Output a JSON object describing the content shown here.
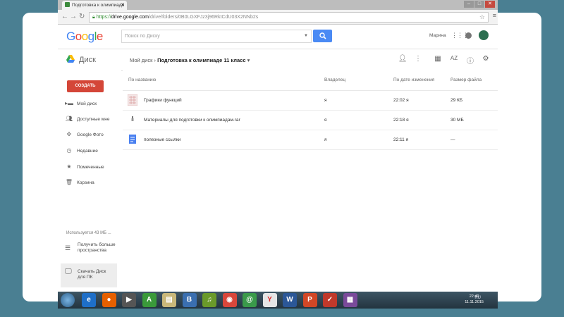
{
  "browser": {
    "tab_title": "Подготовка к олимпиаде",
    "tab_close": "✕",
    "url_scheme": "https://",
    "url_host": "drive.google.com",
    "url_path": "/drive/folders/0B0LGXFJz3j96RktCdU03X2NNb2s"
  },
  "header": {
    "logo_letters": [
      "G",
      "o",
      "o",
      "g",
      "l",
      "e"
    ],
    "logo_colors": [
      "#4285f4",
      "#ea4335",
      "#fbbc05",
      "#4285f4",
      "#34a853",
      "#ea4335"
    ],
    "search_placeholder": "Поиск по Диску",
    "user_name": "Марина"
  },
  "drivebar": {
    "app_name": "Диск",
    "crumb_root": "Мой диск",
    "crumb_sep": "›",
    "crumb_current": "Подготовка к олимпиаде 11 класс"
  },
  "sidebar": {
    "create_label": "СОЗДАТЬ",
    "items": [
      {
        "label": "Мой диск",
        "icon": "folder-icon"
      },
      {
        "label": "Доступные мне",
        "icon": "people-icon"
      },
      {
        "label": "Google Фото",
        "icon": "photos-icon"
      },
      {
        "label": "Недавние",
        "icon": "clock-icon"
      },
      {
        "label": "Помеченные",
        "icon": "star-icon"
      },
      {
        "label": "Корзина",
        "icon": "trash-icon"
      }
    ],
    "storage_text": "Используется 43 МБ ...",
    "get_more_label": "Получить больше пространства",
    "download_label": "Скачать Диск для ПК"
  },
  "table": {
    "headers": {
      "name": "По названию",
      "owner": "Владелец",
      "modified": "По дате изменения",
      "size": "Размер файла"
    },
    "rows": [
      {
        "name": "Графики функций",
        "owner": "я",
        "modified": "22:02 я",
        "size": "29 КБ",
        "type": "image"
      },
      {
        "name": "Материалы для подготовки к олимпиадам.rar",
        "owner": "я",
        "modified": "22:18 я",
        "size": "30 МБ",
        "type": "archive"
      },
      {
        "name": "полезные ссылки",
        "owner": "я",
        "modified": "22:11 я",
        "size": "—",
        "type": "doc"
      }
    ]
  },
  "taskbar": {
    "apps": [
      {
        "icon": "ie-icon",
        "glyph": "e",
        "color": "#1e6fc8"
      },
      {
        "icon": "firefox-icon",
        "glyph": "●",
        "color": "#e66000"
      },
      {
        "icon": "media-player-icon",
        "glyph": "▶",
        "color": "#555555"
      },
      {
        "icon": "a-app-icon",
        "glyph": "A",
        "color": "#3a9a3a"
      },
      {
        "icon": "notes-icon",
        "glyph": "▤",
        "color": "#c9b87a"
      },
      {
        "icon": "b-app-icon",
        "glyph": "B",
        "color": "#3a6fb0"
      },
      {
        "icon": "music-icon",
        "glyph": "♫",
        "color": "#6a9a2a"
      },
      {
        "icon": "chrome-icon",
        "glyph": "◉",
        "color": "#d9473b"
      },
      {
        "icon": "at-app-icon",
        "glyph": "@",
        "color": "#3a9a4a"
      },
      {
        "icon": "yandex-icon",
        "glyph": "Y",
        "color": "#ffffff"
      },
      {
        "icon": "word-icon",
        "glyph": "W",
        "color": "#2b5797"
      },
      {
        "icon": "powerpoint-icon",
        "glyph": "P",
        "color": "#d24726"
      },
      {
        "icon": "task-icon",
        "glyph": "✓",
        "color": "#c0392b"
      },
      {
        "icon": "winrar-icon",
        "glyph": "▦",
        "color": "#7a4a9a"
      }
    ],
    "tray_lang": "RU",
    "clock_time": "22:40",
    "clock_date": "11.11.2015"
  },
  "colors": {
    "accent": "#4a8af4",
    "create": "#d44638",
    "background": "#4a7f92"
  }
}
